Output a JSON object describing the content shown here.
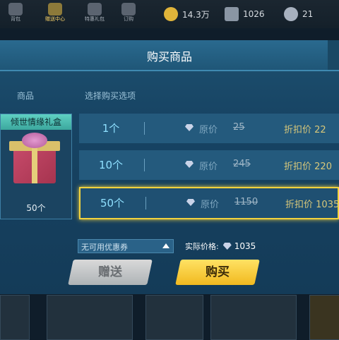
{
  "topbar": {
    "items": [
      {
        "label": "背包",
        "icon": "backpack-icon"
      },
      {
        "label": "赠送中心",
        "icon": "gift-center-icon"
      },
      {
        "label": "特惠礼包",
        "icon": "special-pack-icon"
      },
      {
        "label": "订购",
        "icon": "order-icon"
      }
    ],
    "coins": "14.3万",
    "tickets": "1026",
    "diamonds": "21"
  },
  "modal": {
    "title": "购买商品",
    "col_item": "商品",
    "col_options": "选择购买选项"
  },
  "item": {
    "name": "倾世情缘礼盒",
    "qty": "50个"
  },
  "options": [
    {
      "qty": "1个",
      "orig_label": "原价",
      "orig": "25",
      "disc_label": "折扣价",
      "disc": "22",
      "selected": false
    },
    {
      "qty": "10个",
      "orig_label": "原价",
      "orig": "245",
      "disc_label": "折扣价",
      "disc": "220",
      "selected": false
    },
    {
      "qty": "50个",
      "orig_label": "原价",
      "orig": "1150",
      "disc_label": "折扣价",
      "disc": "1035",
      "selected": true
    }
  ],
  "coupon": {
    "text": "无可用优惠券"
  },
  "actual": {
    "label": "实际价格:",
    "value": "1035"
  },
  "buttons": {
    "gift": "赠送",
    "buy": "购买"
  },
  "colors": {
    "accent_selected": "#f3d33e",
    "buy_button": "#f1b91f"
  }
}
